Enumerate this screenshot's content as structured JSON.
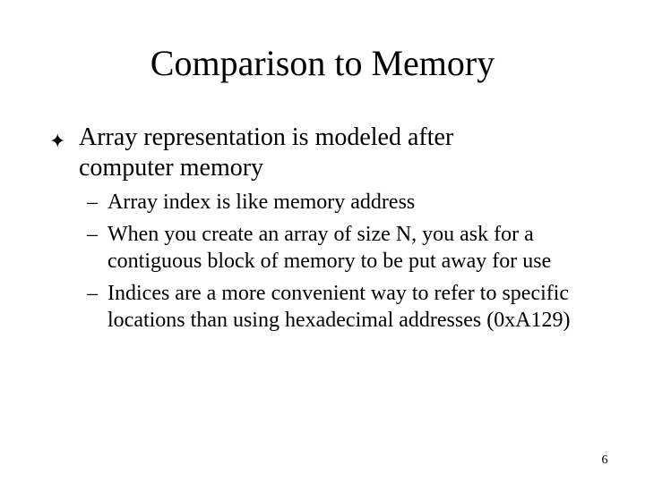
{
  "slide": {
    "title": "Comparison to Memory",
    "bullet": {
      "marker": "✦",
      "text": "Array representation is modeled after computer memory"
    },
    "subbullets": [
      {
        "marker": "–",
        "text": "Array index is like memory address"
      },
      {
        "marker": "–",
        "text": "When you create an array of size N, you ask for a contiguous block of memory to be put away for use"
      },
      {
        "marker": "–",
        "text": "Indices are a more convenient way to refer to specific locations than using hexadecimal addresses (0xA129)"
      }
    ],
    "page_number": "6"
  }
}
